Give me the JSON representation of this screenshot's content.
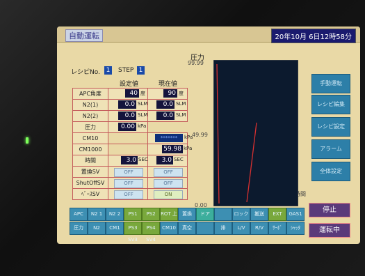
{
  "title": "自動運転",
  "clock": "20年10月 6日12時58分",
  "recipe": {
    "label": "レシピNo.",
    "value": "1"
  },
  "step": {
    "label": "STEP",
    "value": "1"
  },
  "table": {
    "col_setting": "設定値",
    "col_current": "現在値",
    "rows": [
      {
        "label": "APC角度",
        "set": "40",
        "set_unit": "度",
        "cur": "90",
        "cur_unit": "度"
      },
      {
        "label": "N2(1)",
        "set": "0.0",
        "set_unit": "SLM",
        "cur": "0.0",
        "cur_unit": "SLM"
      },
      {
        "label": "N2(2)",
        "set": "0.0",
        "set_unit": "SLM",
        "cur": "0.0",
        "cur_unit": "SLM"
      },
      {
        "label": "圧力",
        "set": "0.00",
        "set_unit": "kPa",
        "cur": "",
        "cur_unit": ""
      },
      {
        "label": "CM10",
        "set": "",
        "set_unit": "",
        "cur": "*******",
        "cur_unit": "kPa"
      },
      {
        "label": "CM1000",
        "set": "",
        "set_unit": "",
        "cur": "59.98",
        "cur_unit": "kPa"
      },
      {
        "label": "時間",
        "set": "3.0",
        "set_unit": "SEC",
        "cur": "3.0",
        "cur_unit": "SEC"
      },
      {
        "label": "置換SV",
        "set": "OFF",
        "set_unit": "",
        "cur": "OFF",
        "cur_unit": ""
      },
      {
        "label": "ShutOffSV",
        "set": "OFF",
        "set_unit": "",
        "cur": "OFF",
        "cur_unit": ""
      },
      {
        "label": "ﾍﾞｰｽSV",
        "set": "OFF",
        "set_unit": "",
        "cur": "ON",
        "cur_unit": ""
      }
    ]
  },
  "chart_data": {
    "type": "line",
    "title": "圧力",
    "xlabel": "時間",
    "yticks": [
      "99.99",
      "49.99",
      "0.00"
    ],
    "ylim": [
      0,
      99.99
    ]
  },
  "side_buttons": [
    "手動運転",
    "レシピ編集",
    "レシピ設定",
    "アラーム",
    "全体設定"
  ],
  "function_keys_row1": [
    "APC",
    "N2 1",
    "N2 2",
    "PS1 SV1",
    "PS2 SV2",
    "ROT 上昇",
    "置換",
    "ドア",
    "",
    "ロック",
    "搬送",
    "EXT",
    "GAS1"
  ],
  "function_keys_row2": [
    "圧力",
    "N2",
    "CM1",
    "PS3 SV3",
    "PS4 SV4",
    "CM10",
    "真空",
    "",
    "排",
    "L/V",
    "R/V",
    "ｻｰﾎﾞ",
    "ｼｬｯﾀ"
  ],
  "stop_label": "停止",
  "run_label": "運転中"
}
